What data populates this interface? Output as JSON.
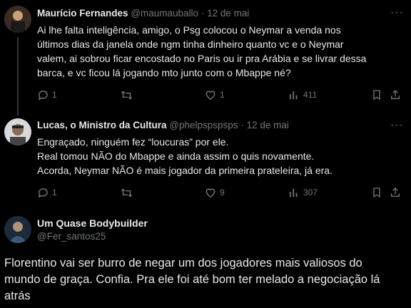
{
  "tweets": [
    {
      "name": "Maurício Fernandes",
      "handle": "@maumauballo",
      "separator": "·",
      "date": "12 de mai",
      "more": "···",
      "lines": [
        "Ai lhe falta inteligência, amigo, o Psg colocou o Neymar a venda nos",
        "últimos dias da janela onde ngm tinha dinheiro quanto vc e o Neymar",
        "valem, ai sobrou ficar encostado no Paris ou ir pra Arábia e se livrar dessa",
        "barca, e vc ficou lá jogando mto junto com o Mbappe né?"
      ],
      "replies": "1",
      "retweets": "",
      "likes": "1",
      "views": "411"
    },
    {
      "name": "Lucas, o Ministro da Cultura",
      "handle": "@phelpspspsps",
      "separator": "·",
      "date": "12 de mai",
      "more": "···",
      "lines": [
        "Engraçado, ninguém fez “loucuras” por ele.",
        "Real tomou NÃO do Mbappe e ainda assim o quis novamente.",
        "Acorda, Neymar NÃO é mais jogador da primeira prateleira, já era."
      ],
      "replies": "1",
      "retweets": "",
      "likes": "9",
      "views": "307"
    }
  ],
  "main_tweet": {
    "name": "Um Quase Bodybuilder",
    "handle": "@Fer_santos25",
    "lines": [
      "Florentino vai ser burro de negar um dos jogadores mais valiosos do",
      "mundo de graça. Confia. Pra ele foi até bom ter melado a negociação lá",
      "atrás"
    ]
  },
  "icons": {
    "reply": "reply-icon",
    "retweet": "retweet-icon",
    "like": "heart-icon",
    "views": "views-icon",
    "bookmark": "bookmark-icon",
    "share": "share-icon"
  },
  "colors": {
    "background": "#000000",
    "text": "#e7e9ea",
    "secondary": "#71767b",
    "thread_line": "#333639"
  }
}
